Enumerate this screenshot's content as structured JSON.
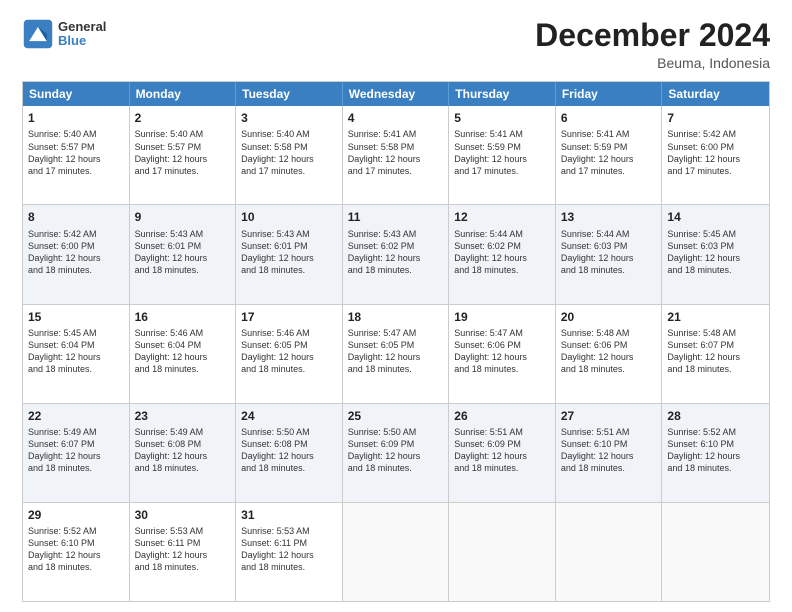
{
  "header": {
    "logo_line1": "General",
    "logo_line2": "Blue",
    "month": "December 2024",
    "location": "Beuma, Indonesia"
  },
  "weekdays": [
    "Sunday",
    "Monday",
    "Tuesday",
    "Wednesday",
    "Thursday",
    "Friday",
    "Saturday"
  ],
  "rows": [
    [
      {
        "day": "1",
        "lines": [
          "Sunrise: 5:40 AM",
          "Sunset: 5:57 PM",
          "Daylight: 12 hours",
          "and 17 minutes."
        ]
      },
      {
        "day": "2",
        "lines": [
          "Sunrise: 5:40 AM",
          "Sunset: 5:57 PM",
          "Daylight: 12 hours",
          "and 17 minutes."
        ]
      },
      {
        "day": "3",
        "lines": [
          "Sunrise: 5:40 AM",
          "Sunset: 5:58 PM",
          "Daylight: 12 hours",
          "and 17 minutes."
        ]
      },
      {
        "day": "4",
        "lines": [
          "Sunrise: 5:41 AM",
          "Sunset: 5:58 PM",
          "Daylight: 12 hours",
          "and 17 minutes."
        ]
      },
      {
        "day": "5",
        "lines": [
          "Sunrise: 5:41 AM",
          "Sunset: 5:59 PM",
          "Daylight: 12 hours",
          "and 17 minutes."
        ]
      },
      {
        "day": "6",
        "lines": [
          "Sunrise: 5:41 AM",
          "Sunset: 5:59 PM",
          "Daylight: 12 hours",
          "and 17 minutes."
        ]
      },
      {
        "day": "7",
        "lines": [
          "Sunrise: 5:42 AM",
          "Sunset: 6:00 PM",
          "Daylight: 12 hours",
          "and 17 minutes."
        ]
      }
    ],
    [
      {
        "day": "8",
        "lines": [
          "Sunrise: 5:42 AM",
          "Sunset: 6:00 PM",
          "Daylight: 12 hours",
          "and 18 minutes."
        ]
      },
      {
        "day": "9",
        "lines": [
          "Sunrise: 5:43 AM",
          "Sunset: 6:01 PM",
          "Daylight: 12 hours",
          "and 18 minutes."
        ]
      },
      {
        "day": "10",
        "lines": [
          "Sunrise: 5:43 AM",
          "Sunset: 6:01 PM",
          "Daylight: 12 hours",
          "and 18 minutes."
        ]
      },
      {
        "day": "11",
        "lines": [
          "Sunrise: 5:43 AM",
          "Sunset: 6:02 PM",
          "Daylight: 12 hours",
          "and 18 minutes."
        ]
      },
      {
        "day": "12",
        "lines": [
          "Sunrise: 5:44 AM",
          "Sunset: 6:02 PM",
          "Daylight: 12 hours",
          "and 18 minutes."
        ]
      },
      {
        "day": "13",
        "lines": [
          "Sunrise: 5:44 AM",
          "Sunset: 6:03 PM",
          "Daylight: 12 hours",
          "and 18 minutes."
        ]
      },
      {
        "day": "14",
        "lines": [
          "Sunrise: 5:45 AM",
          "Sunset: 6:03 PM",
          "Daylight: 12 hours",
          "and 18 minutes."
        ]
      }
    ],
    [
      {
        "day": "15",
        "lines": [
          "Sunrise: 5:45 AM",
          "Sunset: 6:04 PM",
          "Daylight: 12 hours",
          "and 18 minutes."
        ]
      },
      {
        "day": "16",
        "lines": [
          "Sunrise: 5:46 AM",
          "Sunset: 6:04 PM",
          "Daylight: 12 hours",
          "and 18 minutes."
        ]
      },
      {
        "day": "17",
        "lines": [
          "Sunrise: 5:46 AM",
          "Sunset: 6:05 PM",
          "Daylight: 12 hours",
          "and 18 minutes."
        ]
      },
      {
        "day": "18",
        "lines": [
          "Sunrise: 5:47 AM",
          "Sunset: 6:05 PM",
          "Daylight: 12 hours",
          "and 18 minutes."
        ]
      },
      {
        "day": "19",
        "lines": [
          "Sunrise: 5:47 AM",
          "Sunset: 6:06 PM",
          "Daylight: 12 hours",
          "and 18 minutes."
        ]
      },
      {
        "day": "20",
        "lines": [
          "Sunrise: 5:48 AM",
          "Sunset: 6:06 PM",
          "Daylight: 12 hours",
          "and 18 minutes."
        ]
      },
      {
        "day": "21",
        "lines": [
          "Sunrise: 5:48 AM",
          "Sunset: 6:07 PM",
          "Daylight: 12 hours",
          "and 18 minutes."
        ]
      }
    ],
    [
      {
        "day": "22",
        "lines": [
          "Sunrise: 5:49 AM",
          "Sunset: 6:07 PM",
          "Daylight: 12 hours",
          "and 18 minutes."
        ]
      },
      {
        "day": "23",
        "lines": [
          "Sunrise: 5:49 AM",
          "Sunset: 6:08 PM",
          "Daylight: 12 hours",
          "and 18 minutes."
        ]
      },
      {
        "day": "24",
        "lines": [
          "Sunrise: 5:50 AM",
          "Sunset: 6:08 PM",
          "Daylight: 12 hours",
          "and 18 minutes."
        ]
      },
      {
        "day": "25",
        "lines": [
          "Sunrise: 5:50 AM",
          "Sunset: 6:09 PM",
          "Daylight: 12 hours",
          "and 18 minutes."
        ]
      },
      {
        "day": "26",
        "lines": [
          "Sunrise: 5:51 AM",
          "Sunset: 6:09 PM",
          "Daylight: 12 hours",
          "and 18 minutes."
        ]
      },
      {
        "day": "27",
        "lines": [
          "Sunrise: 5:51 AM",
          "Sunset: 6:10 PM",
          "Daylight: 12 hours",
          "and 18 minutes."
        ]
      },
      {
        "day": "28",
        "lines": [
          "Sunrise: 5:52 AM",
          "Sunset: 6:10 PM",
          "Daylight: 12 hours",
          "and 18 minutes."
        ]
      }
    ],
    [
      {
        "day": "29",
        "lines": [
          "Sunrise: 5:52 AM",
          "Sunset: 6:10 PM",
          "Daylight: 12 hours",
          "and 18 minutes."
        ]
      },
      {
        "day": "30",
        "lines": [
          "Sunrise: 5:53 AM",
          "Sunset: 6:11 PM",
          "Daylight: 12 hours",
          "and 18 minutes."
        ]
      },
      {
        "day": "31",
        "lines": [
          "Sunrise: 5:53 AM",
          "Sunset: 6:11 PM",
          "Daylight: 12 hours",
          "and 18 minutes."
        ]
      },
      {
        "day": "",
        "lines": []
      },
      {
        "day": "",
        "lines": []
      },
      {
        "day": "",
        "lines": []
      },
      {
        "day": "",
        "lines": []
      }
    ]
  ]
}
